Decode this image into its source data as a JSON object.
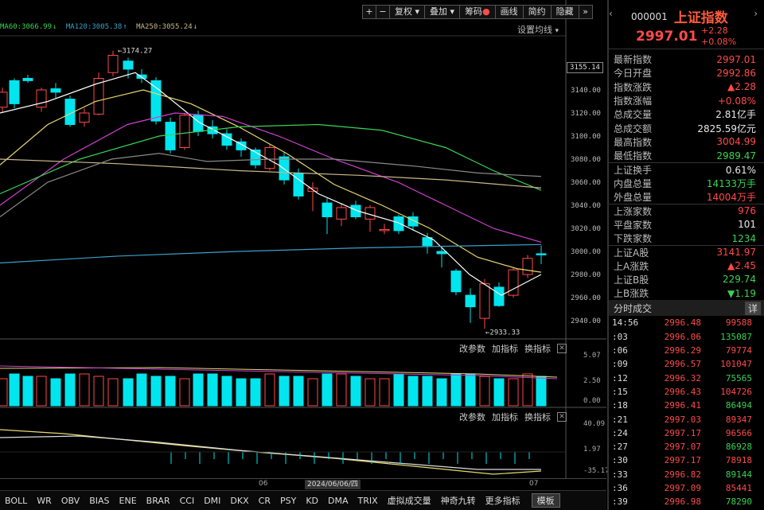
{
  "toolbar": {
    "plus": "+",
    "minus": "−",
    "fuquan": "复权",
    "diejia": "叠加",
    "chouma": "筹码",
    "huaxian": "画线",
    "jianyue": "简约",
    "yincang": "隐藏",
    "expand": "»"
  },
  "ma_legend": {
    "ma60": "MA60:3066.99",
    "ma120": "MA120:3005.38",
    "ma250": "MA250:3055.24",
    "settings": "设置均线"
  },
  "price_axis": {
    "current": "3155.14",
    "ticks": [
      "3140.00",
      "3120.00",
      "3100.00",
      "3080.00",
      "3060.00",
      "3040.00",
      "3020.00",
      "3000.00",
      "2980.00",
      "2960.00",
      "2940.00"
    ],
    "high_mark": "3174.27",
    "low_mark": "2933.33"
  },
  "sub_panel_1": {
    "tools": [
      "改参数",
      "加指标",
      "换指标"
    ],
    "scale": [
      "5.07",
      "2.50",
      "0.00"
    ]
  },
  "sub_panel_2": {
    "tools": [
      "改参数",
      "加指标",
      "换指标"
    ],
    "scale": [
      "40.09",
      "1.97",
      "-35.17"
    ]
  },
  "date_bar": {
    "tick1": "06",
    "selected": "2024/06/06/四",
    "tick2": "07"
  },
  "indicator_tabs": [
    "BOLL",
    "WR",
    "OBV",
    "BIAS",
    "ENE",
    "BRAR",
    "CCI",
    "DMI",
    "DKX",
    "CR",
    "PSY",
    "KD",
    "DMA",
    "TRIX",
    "虚拟成交量",
    "神奇九转",
    "更多指标",
    "模板"
  ],
  "side": {
    "code": "000001",
    "name": "上证指数",
    "price": "2997.01",
    "change": "+2.28",
    "change_pct": "+0.08%",
    "nav_left": "‹",
    "nav_right": "›",
    "info": [
      {
        "label": "最新指数",
        "value": "2997.01",
        "color": "#ff4a4a"
      },
      {
        "label": "今日开盘",
        "value": "2992.86",
        "color": "#ff4a4a"
      },
      {
        "label": "指数涨跌",
        "value": "▲2.28",
        "color": "#ff4a4a"
      },
      {
        "label": "指数涨幅",
        "value": "+0.08%",
        "color": "#ff4a4a"
      },
      {
        "label": "总成交量",
        "value": "2.81亿手",
        "color": "#e8e8e8"
      },
      {
        "label": "总成交额",
        "value": "2825.59亿元",
        "color": "#e8e8e8"
      },
      {
        "label": "最高指数",
        "value": "3004.99",
        "color": "#ff4a4a"
      },
      {
        "label": "最低指数",
        "value": "2989.47",
        "color": "#39d353"
      },
      {
        "label": "上证换手",
        "value": "0.61%",
        "color": "#e8e8e8",
        "sep": true
      },
      {
        "label": "内盘总量",
        "value": "14133万手",
        "color": "#39d353"
      },
      {
        "label": "外盘总量",
        "value": "14004万手",
        "color": "#ff4a4a"
      },
      {
        "label": "上涨家数",
        "value": "976",
        "color": "#ff4a4a",
        "sep": true
      },
      {
        "label": "平盘家数",
        "value": "101",
        "color": "#e8e8e8"
      },
      {
        "label": "下跌家数",
        "value": "1234",
        "color": "#39d353"
      },
      {
        "label": "上证A股",
        "value": "3141.97",
        "color": "#ff4a4a",
        "sep": true
      },
      {
        "label": "上A涨跌",
        "value": "▲2.45",
        "color": "#ff4a4a"
      },
      {
        "label": "上证B股",
        "value": "229.74",
        "color": "#39d353"
      },
      {
        "label": "上B涨跌",
        "value": "▼1.19",
        "color": "#39d353"
      }
    ],
    "trades_title": "分时成交",
    "trades_tail": "详",
    "trades": [
      {
        "time": "14:56",
        "price": "2996.48",
        "vol": "99588",
        "vcolor": "#ff4a4a"
      },
      {
        "time": ":03",
        "price": "2996.06",
        "vol": "135087",
        "vcolor": "#39d353"
      },
      {
        "time": ":06",
        "price": "2996.29",
        "vol": "79774",
        "vcolor": "#ff4a4a"
      },
      {
        "time": ":09",
        "price": "2996.57",
        "vol": "101047",
        "vcolor": "#ff4a4a"
      },
      {
        "time": ":12",
        "price": "2996.32",
        "vol": "75565",
        "vcolor": "#39d353"
      },
      {
        "time": ":15",
        "price": "2996.43",
        "vol": "104726",
        "vcolor": "#ff4a4a"
      },
      {
        "time": ":18",
        "price": "2996.41",
        "vol": "86494",
        "vcolor": "#39d353"
      },
      {
        "time": ":21",
        "price": "2997.03",
        "vol": "89347",
        "vcolor": "#ff4a4a"
      },
      {
        "time": ":24",
        "price": "2997.17",
        "vol": "96566",
        "vcolor": "#ff4a4a"
      },
      {
        "time": ":27",
        "price": "2997.07",
        "vol": "86928",
        "vcolor": "#39d353"
      },
      {
        "time": ":30",
        "price": "2997.17",
        "vol": "78918",
        "vcolor": "#ff4a4a"
      },
      {
        "time": ":33",
        "price": "2996.82",
        "vol": "89144",
        "vcolor": "#39d353"
      },
      {
        "time": ":36",
        "price": "2997.09",
        "vol": "85441",
        "vcolor": "#ff4a4a"
      },
      {
        "time": ":39",
        "price": "2996.98",
        "vol": "78290",
        "vcolor": "#39d353"
      }
    ]
  },
  "colors": {
    "up": "#ff4a4a",
    "down": "#00e5ee",
    "ma5": "#ffffff",
    "ma10": "#e8d870",
    "ma20": "#d040d0",
    "ma60": "#39d353",
    "ma120": "#3aa0c8",
    "ma250": "#c8b888",
    "boll": "#aaaaaa"
  }
}
